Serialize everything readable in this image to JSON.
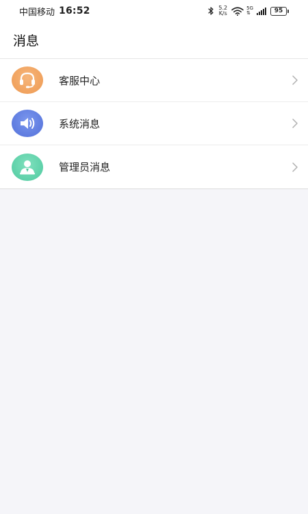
{
  "status_bar": {
    "carrier": "中国移动",
    "time": "16:52",
    "net_speed_value": "5.2",
    "net_speed_unit": "K/s",
    "network_type": "5G",
    "battery_level": "95",
    "icons": [
      "bluetooth-icon",
      "wifi-icon",
      "cellular-signal-icon",
      "battery-icon"
    ]
  },
  "header": {
    "title": "消息"
  },
  "messages": {
    "items": [
      {
        "label": "客服中心",
        "icon": "headset-icon",
        "color": "#f0a060"
      },
      {
        "label": "系统消息",
        "icon": "speaker-icon",
        "color": "#5a7ce0"
      },
      {
        "label": "管理员消息",
        "icon": "admin-user-icon",
        "color": "#58d0a8"
      }
    ]
  },
  "colors": {
    "background": "#f5f5f9",
    "card": "#ffffff",
    "chevron": "#b0b0b0"
  }
}
